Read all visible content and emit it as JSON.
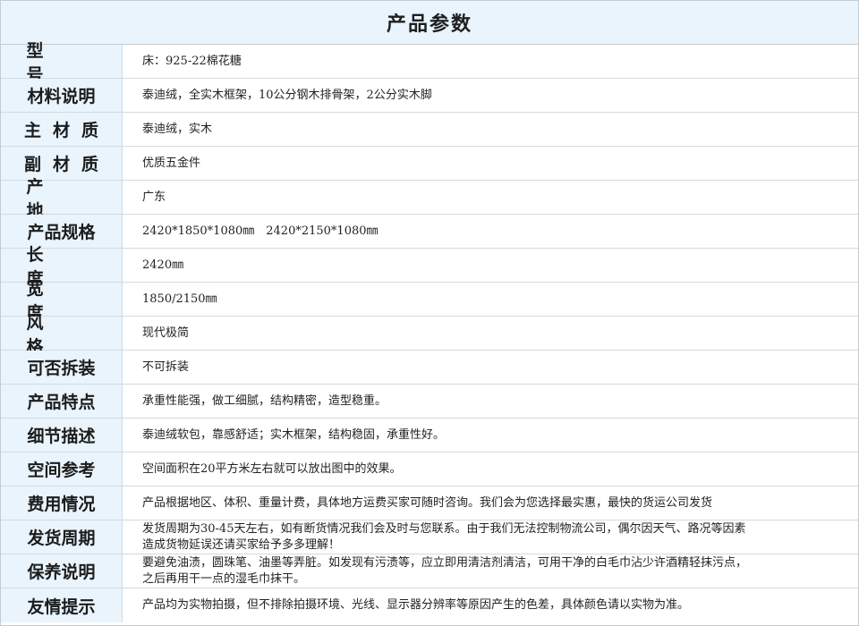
{
  "page": {
    "title": "产品参数"
  },
  "params": [
    {
      "label": "型　号",
      "value": "床：925-22棉花糖"
    },
    {
      "label": "材料说明",
      "value": "泰迪绒，全实木框架，10公分钢木排骨架，2公分实木脚"
    },
    {
      "label": "主材质",
      "value": "泰迪绒，实木"
    },
    {
      "label": "副材质",
      "value": "优质五金件"
    },
    {
      "label": "产　地",
      "value": "广东"
    },
    {
      "label": "产品规格",
      "value": "2420*1850*1080㎜　2420*2150*1080㎜"
    },
    {
      "label": "长　度",
      "value": "2420㎜"
    },
    {
      "label": "宽　度",
      "value": "1850/2150㎜"
    },
    {
      "label": "风　格",
      "value": "现代极简"
    },
    {
      "label": "可否拆装",
      "value": "不可拆装"
    },
    {
      "label": "产品特点",
      "value": "承重性能强，做工细腻，结构精密，造型稳重。"
    },
    {
      "label": "细节描述",
      "value": "泰迪绒软包，靠感舒适；实木框架，结构稳固，承重性好。"
    },
    {
      "label": "空间参考",
      "value": "空间面积在20平方米左右就可以放出图中的效果。"
    },
    {
      "label": "费用情况",
      "value": "产品根据地区、体积、重量计费，具体地方运费买家可随时咨询。我们会为您选择最实惠，最快的货运公司发货"
    },
    {
      "label": "发货周期",
      "value_lines": [
        "发货周期为30-45天左右，如有断货情况我们会及时与您联系。由于我们无法控制物流公司，偶尔因天气、路况等因素",
        "造成货物延误还请买家给予多多理解！"
      ]
    },
    {
      "label": "保养说明",
      "value_lines": [
        "要避免油渍，圆珠笔、油墨等弄脏。如发现有污渍等，应立即用清洁剂清洁，可用干净的白毛巾沾少许酒精轻抹污点，",
        "之后再用干一点的湿毛巾抹干。"
      ]
    },
    {
      "label": "友情提示",
      "value": "产品均为实物拍摄，但不排除拍摄环境、光线、显示器分辨率等原因产生的色差，具体颜色请以实物为准。"
    }
  ]
}
